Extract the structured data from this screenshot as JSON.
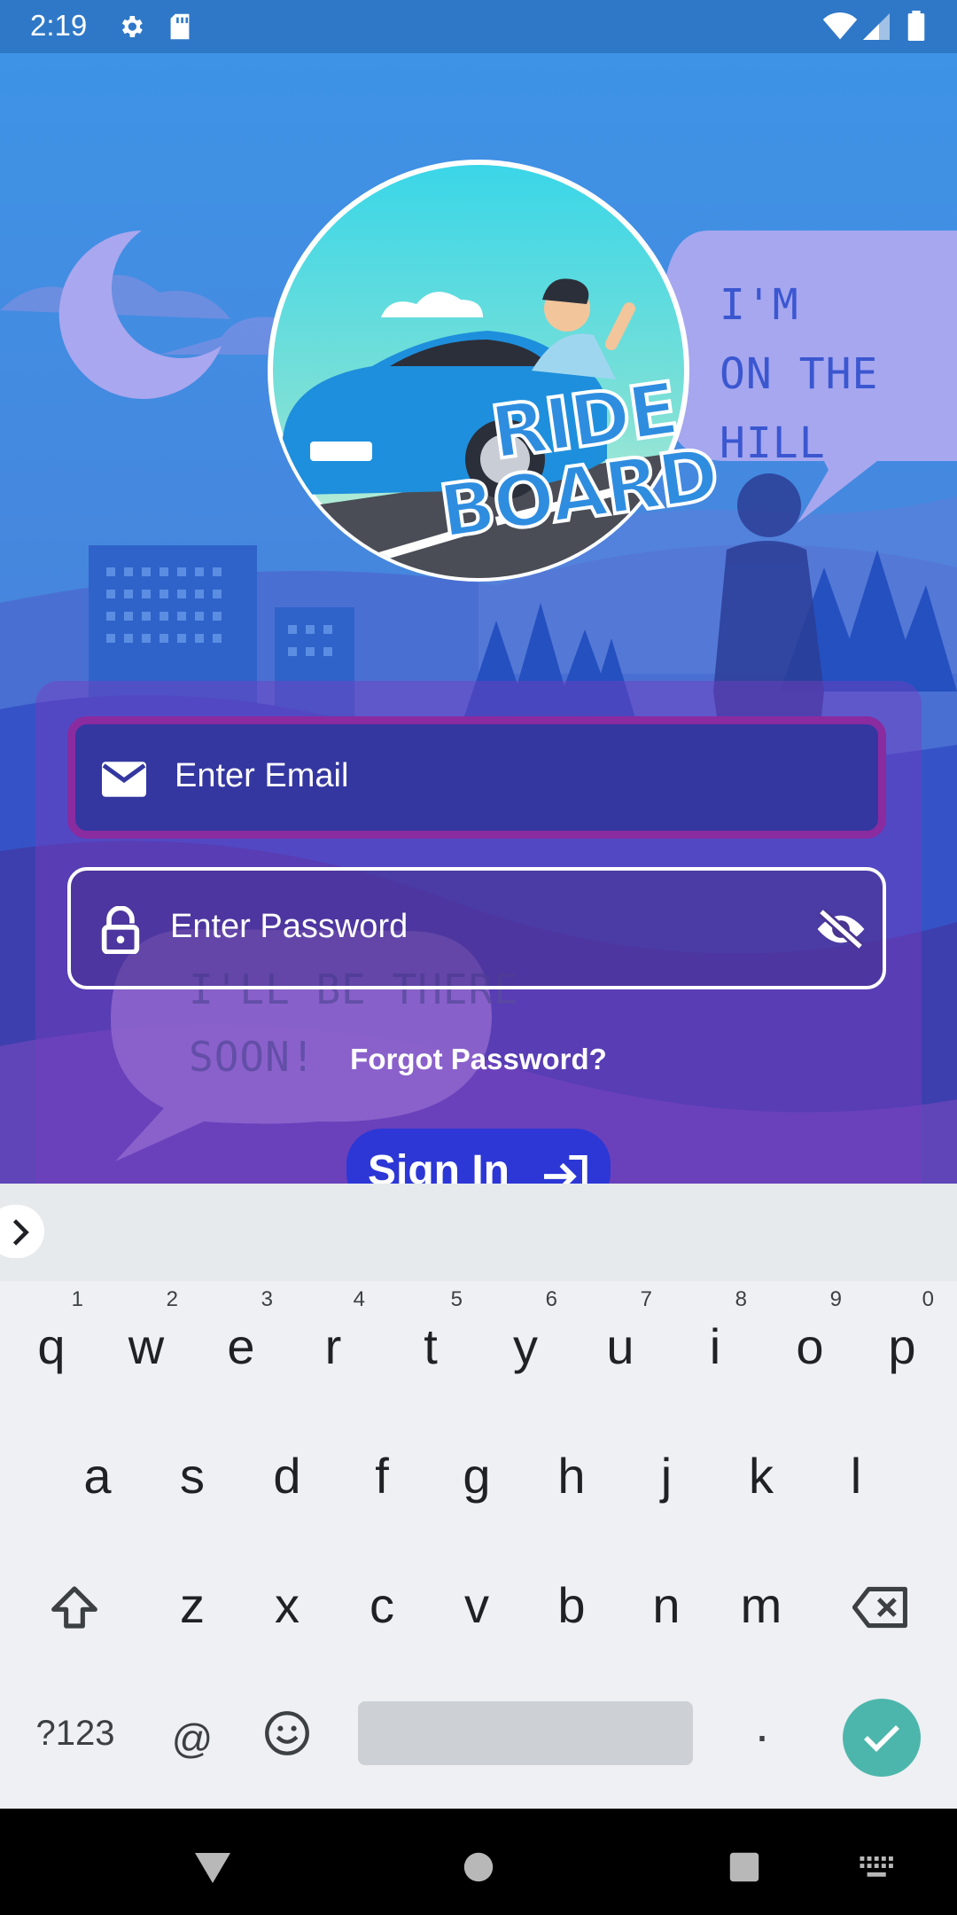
{
  "status_bar": {
    "time": "2:19",
    "icons": [
      "gear-icon",
      "sd-card-icon",
      "wifi-icon",
      "signal-icon",
      "battery-icon"
    ]
  },
  "scene": {
    "bubble_top": {
      "line1": "I'M",
      "line2": "ON THE HILL"
    },
    "bubble_bottom": {
      "line1": "I'LL BE THERE",
      "line2": "SOON!"
    }
  },
  "logo": {
    "line1": "RIDE",
    "line2": "BOARD"
  },
  "login": {
    "email_placeholder": "Enter Email",
    "password_placeholder": "Enter Password",
    "forgot_password": "Forgot Password?",
    "sign_in": "Sign In"
  },
  "keyboard": {
    "row1": [
      {
        "key": "q",
        "hint": "1"
      },
      {
        "key": "w",
        "hint": "2"
      },
      {
        "key": "e",
        "hint": "3"
      },
      {
        "key": "r",
        "hint": "4"
      },
      {
        "key": "t",
        "hint": "5"
      },
      {
        "key": "y",
        "hint": "6"
      },
      {
        "key": "u",
        "hint": "7"
      },
      {
        "key": "i",
        "hint": "8"
      },
      {
        "key": "o",
        "hint": "9"
      },
      {
        "key": "p",
        "hint": "0"
      }
    ],
    "row2": [
      "a",
      "s",
      "d",
      "f",
      "g",
      "h",
      "j",
      "k",
      "l"
    ],
    "row3": [
      "z",
      "x",
      "c",
      "v",
      "b",
      "n",
      "m"
    ],
    "symbols_key": "?123",
    "at_key": "@",
    "period_key": "."
  },
  "colors": {
    "sky": "#3b86e0",
    "form_overlay": "#7a3cbe",
    "email_border": "#8a2ba0",
    "sign_in_button": "#2c37d6",
    "enter_key": "#4db6ac"
  }
}
